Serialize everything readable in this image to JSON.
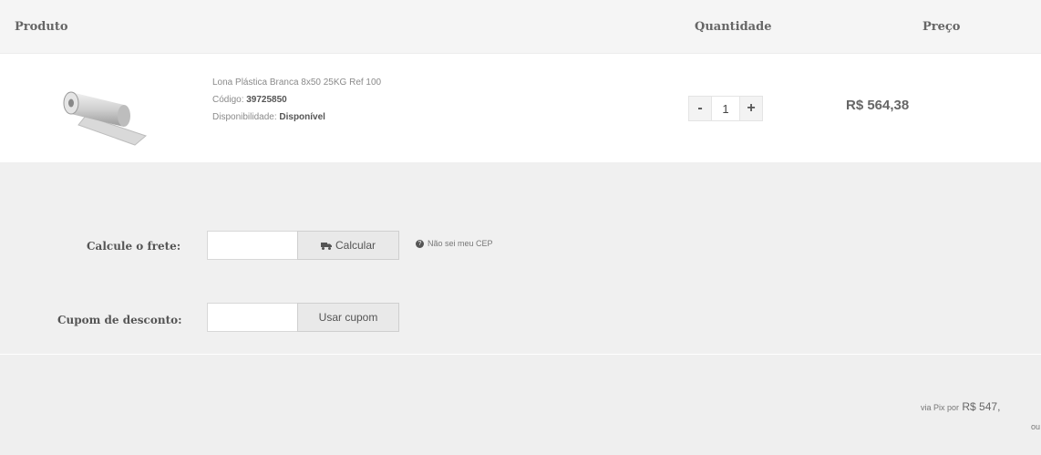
{
  "header": {
    "produto": "Produto",
    "quantidade": "Quantidade",
    "preco": "Preço"
  },
  "product": {
    "name": "Lona Plástica Branca 8x50 25KG Ref 100",
    "code_label": "Código:",
    "code_value": "39725850",
    "availability_label": "Disponibilidade:",
    "availability_value": "Disponível",
    "quantity": "1",
    "minus": "-",
    "plus": "+",
    "price": "R$ 564,38",
    "image_icon": "rolled-plastic-tarp"
  },
  "shipping": {
    "label": "Calcule o frete:",
    "input_value": "",
    "button_label": "Calcular",
    "button_icon": "truck-icon",
    "help_text": "Não sei meu CEP"
  },
  "coupon": {
    "label": "Cupom de desconto:",
    "input_value": "",
    "button_label": "Usar cupom"
  },
  "totals": {
    "pix_prefix": "via Pix por",
    "pix_value": "R$ 547,",
    "trailing": "ou"
  }
}
